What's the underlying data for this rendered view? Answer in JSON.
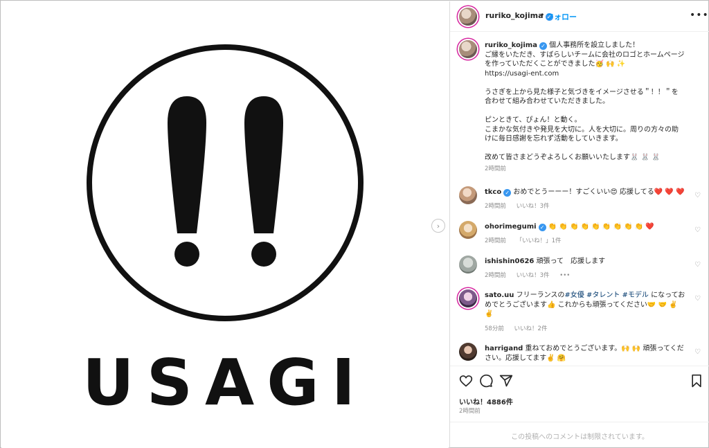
{
  "post": {
    "logo_text": "USAGI",
    "next_glyph": "›"
  },
  "header": {
    "username": "ruriko_kojima",
    "verified_glyph": "✓",
    "separator": "•",
    "follow_label": "フォロー",
    "more_glyph": "•••"
  },
  "caption": {
    "username": "ruriko_kojima",
    "lines": [
      "個人事務所を設立しました！",
      "ご縁をいただき、すばらしいチームに会社のロゴとホームページ",
      "を作っていただくことができました🥳 🙌 ✨",
      "https://usagi-ent.com",
      "",
      "うさぎを上から見た様子と気づきをイメージさせる＂！！＂を",
      "合わせて組み合わせていただきました。",
      "",
      "ピンときて、ぴょん！と動く。",
      "こまかな気付きや発見を大切に。人を大切に。周りの方々の助",
      "けに毎日感謝を忘れず活動をしていきます。",
      "",
      "改めて皆さまどうぞよろしくお願いいたします🐰 🐰 🐰"
    ],
    "time": "2時間前"
  },
  "comments": [
    {
      "username": "tkco",
      "verified": true,
      "text": "おめでとうーーー！すごくいい😍 応援してる❤️ ❤️ ❤️",
      "time": "2時間前",
      "likes": "いいね！3件",
      "extra": ""
    },
    {
      "username": "ohorimegumi",
      "verified": true,
      "text": "👏 👏 👏 👏 👏 👏 👏 👏 👏 ❤️",
      "time": "2時間前",
      "likes": "「いいね！」1件",
      "extra": ""
    },
    {
      "username": "ishishin0626",
      "verified": false,
      "text": "頑張って　応援します",
      "time": "2時間前",
      "likes": "いいね！3件",
      "extra": "•••"
    },
    {
      "username": "sato.uu",
      "verified": false,
      "text_before": "フリーランスの",
      "hashtags": "#女優 #タレント #モデル",
      "text_after": "になってお",
      "line2": "めでとうございます👍 これからも頑張ってください🤝 🤝 ✌️",
      "line3": "✌️",
      "time": "58分前",
      "likes": "いいね！2件",
      "extra": ""
    },
    {
      "username": "harrigand",
      "verified": false,
      "text": "重ねておめでとうございます。🙌 🙌 頑張ってくだ",
      "line2": "さい。応援してます✌️ 🤗",
      "time": "",
      "likes": "",
      "extra": ""
    }
  ],
  "actions": {
    "likes": "いいね！4886件",
    "time": "2時間前",
    "restricted_notice": "この投稿へのコメントは制限されています。"
  },
  "icons": [
    "heart-icon",
    "comment-icon",
    "share-icon",
    "bookmark-icon",
    "more-icon",
    "verified-icon",
    "chevron-right-icon"
  ],
  "colors": {
    "link_blue": "#0095f6",
    "verified_blue": "#3897f0",
    "muted": "#8e8e8e",
    "text": "#262626"
  }
}
